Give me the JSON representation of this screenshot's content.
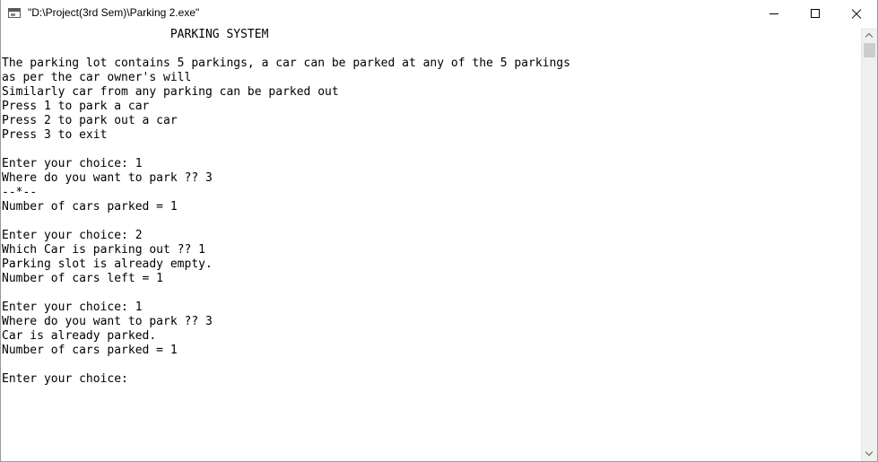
{
  "window": {
    "title": "\"D:\\Project(3rd Sem)\\Parking 2.exe\"",
    "icon": "console-app-icon",
    "controls": [
      "minimize-icon",
      "maximize-icon",
      "close-icon"
    ]
  },
  "console": {
    "lines": [
      "                        PARKING SYSTEM",
      "",
      "The parking lot contains 5 parkings, a car can be parked at any of the 5 parkings",
      "as per the car owner's will",
      "Similarly car from any parking can be parked out",
      "Press 1 to park a car",
      "Press 2 to park out a car",
      "Press 3 to exit",
      "",
      "Enter your choice: 1",
      "Where do you want to park ?? 3",
      "--*--",
      "Number of cars parked = 1",
      "",
      "Enter your choice: 2",
      "Which Car is parking out ?? 1",
      "Parking slot is already empty.",
      "Number of cars left = 1",
      "",
      "Enter your choice: 1",
      "Where do you want to park ?? 3",
      "Car is already parked.",
      "Number of cars parked = 1",
      "",
      "Enter your choice: "
    ]
  }
}
